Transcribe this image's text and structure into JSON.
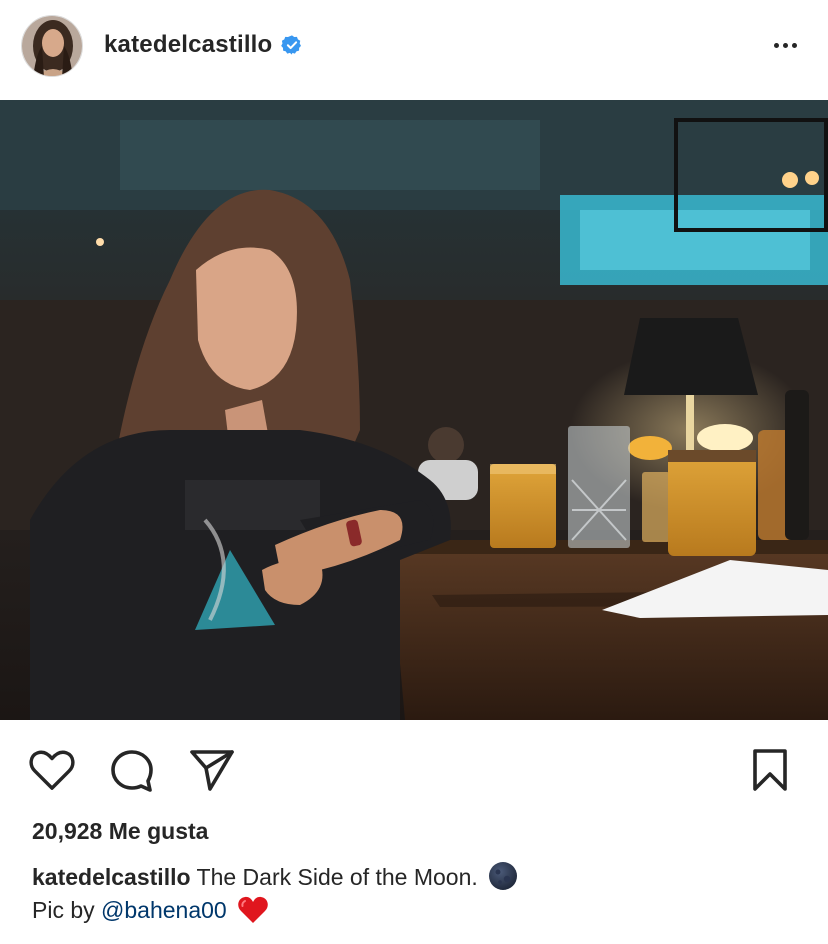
{
  "header": {
    "username": "katedelcastillo",
    "verified": true,
    "more_icon": "ellipsis-icon"
  },
  "post": {
    "image_alt": "Woman in black band t-shirt leaning on a bar counter with cocktails"
  },
  "actions": {
    "like_icon": "heart-icon",
    "comment_icon": "comment-icon",
    "share_icon": "paper-plane-icon",
    "save_icon": "bookmark-icon"
  },
  "likes": {
    "count": "20,928",
    "label": "Me gusta"
  },
  "caption": {
    "username": "katedelcastillo",
    "text": "The Dark Side of the Moon.",
    "line2_prefix": "Pic by",
    "mention": "@bahena00"
  },
  "colors": {
    "text": "#262626",
    "verified_blue": "#3897f0",
    "mention": "#00376b",
    "heart_red": "#e0161e"
  }
}
